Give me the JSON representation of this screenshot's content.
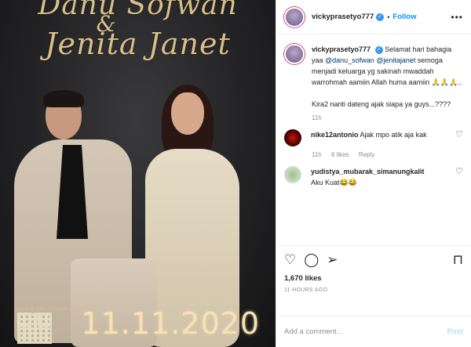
{
  "photo": {
    "title_line1": "Danu Sofwan",
    "title_line2": "&",
    "title_line3": "Jenita Janet",
    "camera_text": "TURN ON YOUR CAMERA",
    "date": "11.11.2020"
  },
  "header": {
    "username": "vickyprasetyo777",
    "dot": "•",
    "follow_label": "Follow",
    "more_label": "•••"
  },
  "caption": {
    "username": "vickyprasetyo777",
    "text_before": "Selamat hari bahagia yaa",
    "mention1": "@danu_sofwan",
    "mention2": "@jenitajanet",
    "text_after": "semoga menjadi keluarga yg sakinah mwaddah warrohmah aamiin Allah huma aamiin 🙏🙏🙏..",
    "text2": "Kira2 nanti dateng ajak siapa ya guys...????",
    "time": "11h"
  },
  "comments": [
    {
      "username": "nike12antonio",
      "text": "Ajak mpo atik aja kak",
      "time": "11h",
      "likes": "6 likes",
      "reply": "Reply"
    },
    {
      "username": "yudistya_mubarak_simanungkalit",
      "text": "Aku Kuat😂😂"
    }
  ],
  "actions": {
    "likes": "1,670 likes",
    "time": "11 HOURS AGO"
  },
  "add_comment": {
    "placeholder": "Add a comment...",
    "post_label": "Post"
  },
  "colors": {
    "accent": "#0095f6",
    "gold": "#d8bf87",
    "post_disabled": "#b2dffc"
  }
}
